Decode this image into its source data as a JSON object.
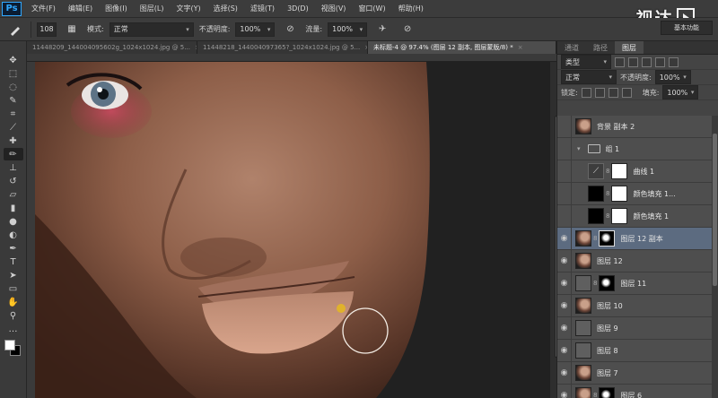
{
  "app": {
    "logo": "Ps"
  },
  "menu": [
    "文件(F)",
    "编辑(E)",
    "图像(I)",
    "图层(L)",
    "文字(Y)",
    "选择(S)",
    "滤镜(T)",
    "3D(D)",
    "视图(V)",
    "窗口(W)",
    "帮助(H)"
  ],
  "watermark": {
    "text": "视达"
  },
  "options": {
    "brush_size": "108",
    "mode_label": "模式:",
    "mode_value": "正常",
    "opacity_label": "不透明度:",
    "opacity_value": "100%",
    "flow_label": "流量:",
    "flow_value": "100%",
    "workspace": "基本功能"
  },
  "tabs": [
    {
      "label": "11448209_144004095602g_1024x1024.jpg @ 5...",
      "active": false
    },
    {
      "label": "11448218_144004097365?_1024x1024.jpg @ 5...",
      "active": false
    },
    {
      "label": "未标题-4 @ 97.4% (图层 12 副本, 图层蒙版/8) *",
      "active": true
    }
  ],
  "panel": {
    "tabs": [
      "通道",
      "路径",
      "图层"
    ],
    "active_tab": "图层",
    "kind_label": "类型",
    "blend_mode": "正常",
    "opacity_label": "不透明度:",
    "opacity_value": "100%",
    "lock_label": "锁定:",
    "fill_label": "填充:",
    "fill_value": "100%"
  },
  "layers": [
    {
      "name": "背景 副本 2",
      "visible": false,
      "thumb": "face",
      "mask": null,
      "indent": false
    },
    {
      "name": "组 1",
      "visible": false,
      "thumb": "folder",
      "mask": null,
      "indent": false
    },
    {
      "name": "曲线 1",
      "visible": false,
      "thumb": "curves",
      "mask": "white",
      "indent": true
    },
    {
      "name": "颜色填充 1...",
      "visible": false,
      "thumb": "black",
      "mask": "white",
      "indent": true
    },
    {
      "name": "颜色填充 1",
      "visible": false,
      "thumb": "black",
      "mask": "white",
      "indent": true
    },
    {
      "name": "图层 12 副本",
      "visible": true,
      "thumb": "face",
      "mask": "mask",
      "indent": false,
      "selected": true
    },
    {
      "name": "图层 12",
      "visible": true,
      "thumb": "face",
      "mask": null,
      "indent": false
    },
    {
      "name": "图层 11",
      "visible": true,
      "thumb": "grey",
      "mask": "mask",
      "indent": false
    },
    {
      "name": "图层 10",
      "visible": true,
      "thumb": "face",
      "mask": null,
      "indent": false
    },
    {
      "name": "图层 9",
      "visible": true,
      "thumb": "grey",
      "mask": null,
      "indent": false
    },
    {
      "name": "图层 8",
      "visible": true,
      "thumb": "grey",
      "mask": null,
      "indent": false
    },
    {
      "name": "图层 7",
      "visible": true,
      "thumb": "face",
      "mask": null,
      "indent": false
    },
    {
      "name": "图层 6",
      "visible": true,
      "thumb": "face",
      "mask": "mask",
      "indent": false
    }
  ],
  "icons": {
    "tools": [
      "move-icon",
      "marquee-icon",
      "lasso-icon",
      "quick-select-icon",
      "crop-icon",
      "eyedropper-icon",
      "healing-icon",
      "brush-icon",
      "stamp-icon",
      "history-brush-icon",
      "eraser-icon",
      "gradient-icon",
      "blur-icon",
      "dodge-icon",
      "pen-icon",
      "type-icon",
      "path-select-icon",
      "shape-icon",
      "hand-icon",
      "zoom-icon"
    ]
  }
}
